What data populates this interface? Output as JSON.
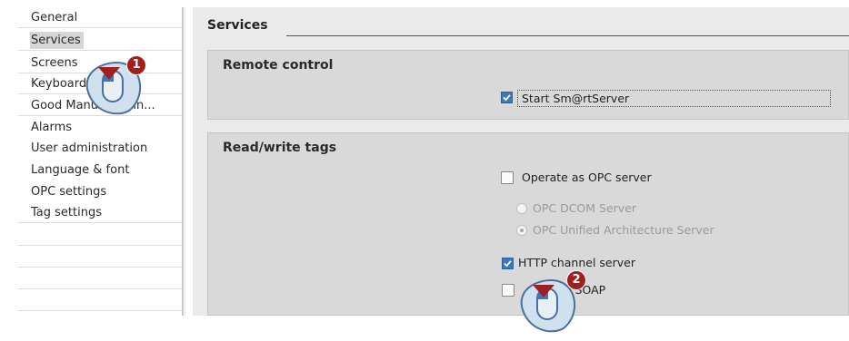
{
  "nav": {
    "items": [
      {
        "label": "General"
      },
      {
        "label": "Services"
      },
      {
        "label": "Screens"
      },
      {
        "label": "Keyboard"
      },
      {
        "label": "Good Manufacturin..."
      },
      {
        "label": "Alarms"
      },
      {
        "label": "User administration"
      },
      {
        "label": "Language & font"
      },
      {
        "label": "OPC settings"
      },
      {
        "label": "Tag settings"
      }
    ],
    "selected": "Services"
  },
  "main": {
    "heading": "Services",
    "remote_control": {
      "title": "Remote control",
      "start_smartserver": {
        "label": "Start Sm@rtServer",
        "checked": true
      }
    },
    "read_write_tags": {
      "title": "Read/write tags",
      "opc_server": {
        "label": "Operate as OPC server",
        "checked": false
      },
      "opc_dcom": {
        "label": "OPC DCOM Server",
        "selected": false,
        "enabled": false
      },
      "opc_ua": {
        "label": "OPC Unified Architecture Server",
        "selected": true,
        "enabled": false
      },
      "http_channel": {
        "label": "HTTP channel server",
        "checked": true
      },
      "soap": {
        "label": "ce SOAP",
        "checked": false
      }
    }
  },
  "callouts": [
    {
      "number": "1"
    },
    {
      "number": "2"
    }
  ],
  "colors": {
    "badge": "#a02020",
    "mouse": "#dfe9f1",
    "arrow": "#a02020"
  }
}
